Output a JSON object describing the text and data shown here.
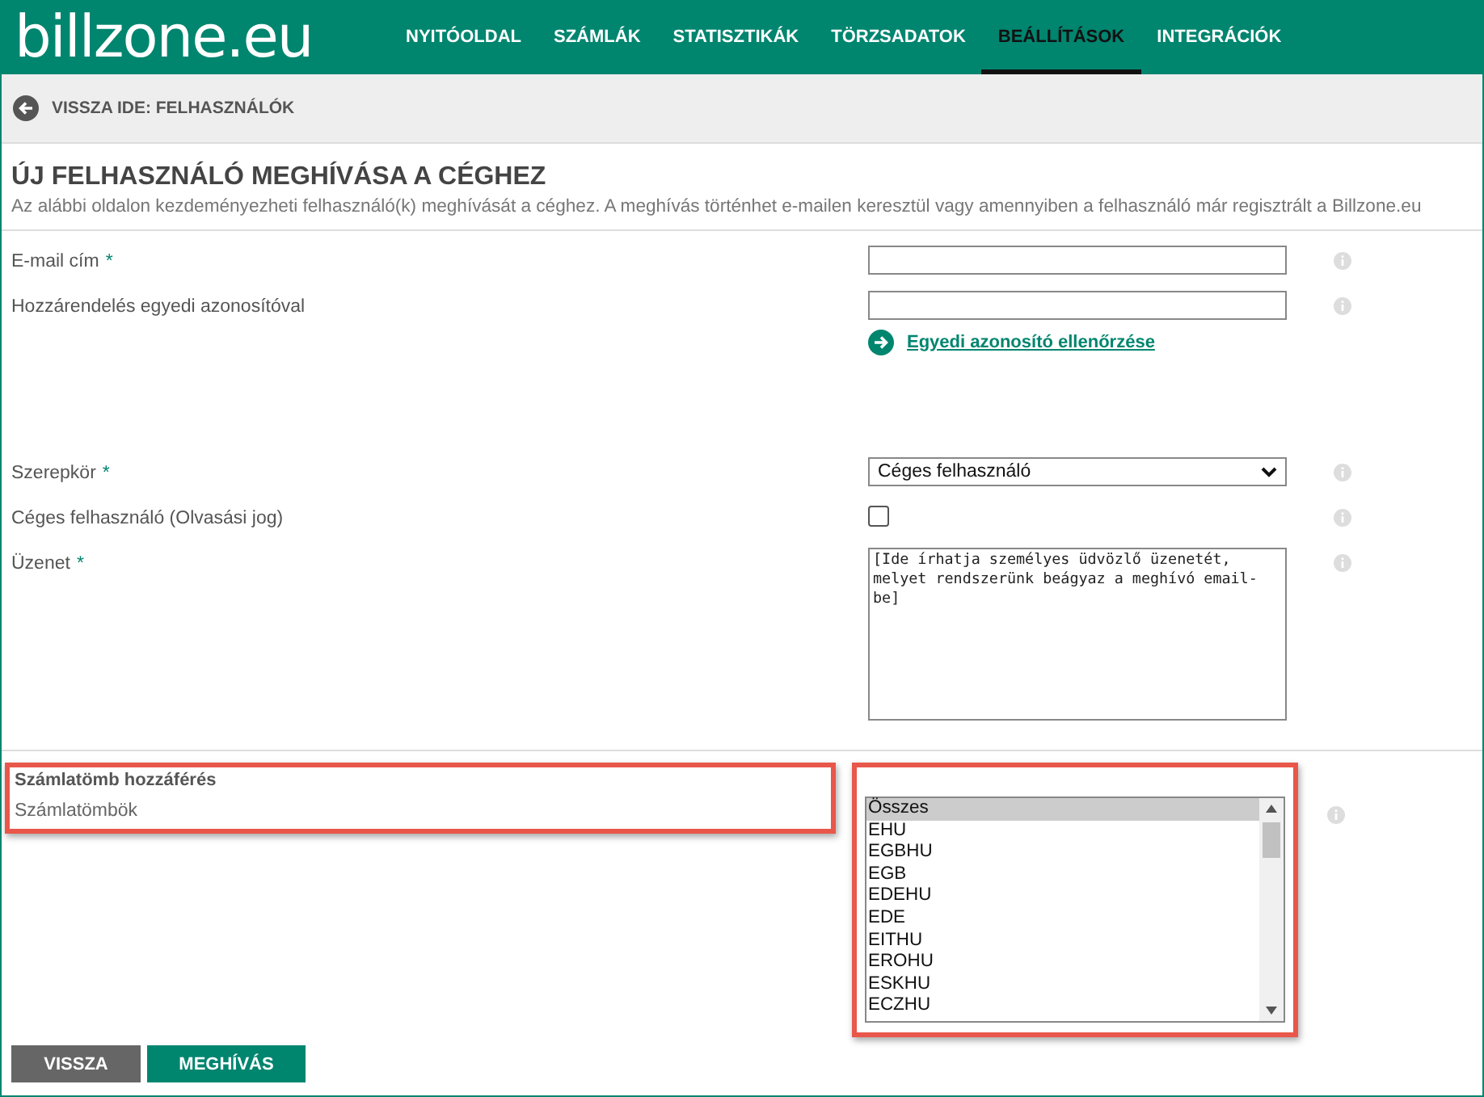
{
  "logo": "billzone.eu",
  "nav": [
    {
      "label": "NYITÓOLDAL",
      "selected": false
    },
    {
      "label": "SZÁMLÁK",
      "selected": false
    },
    {
      "label": "STATISZTIKÁK",
      "selected": false
    },
    {
      "label": "TÖRZSADATOK",
      "selected": false
    },
    {
      "label": "BEÁLLÍTÁSOK",
      "selected": true
    },
    {
      "label": "INTEGRÁCIÓK",
      "selected": false
    }
  ],
  "back_link": "VISSZA IDE: FELHASZNÁLÓK",
  "title": "ÚJ FELHASZNÁLÓ MEGHÍVÁSA A CÉGHEZ",
  "description": "Az alábbi oldalon kezdeményezheti felhasználó(k) meghívását a céghez. A meghívás történhet e-mailen keresztül vagy amennyiben a felhasználó már regisztrált a Billzone.eu",
  "fields": [
    {
      "kind": "text",
      "label": "E-mail cím",
      "required_mark": "*"
    },
    {
      "kind": "text",
      "label": "Hozzárendelés egyedi azonosítóval",
      "link": "Egyedi azonosító ellenőrzése"
    },
    {
      "kind": "select",
      "label": "Szerepkör",
      "required_mark": "*",
      "value": "Céges felhasználó"
    },
    {
      "kind": "checkbox",
      "label": "Céges felhasználó (Olvasási jog)",
      "checked": false
    },
    {
      "kind": "textarea",
      "label": "Üzenet",
      "required_mark": "*",
      "value": "[Ide írhatja személyes üdvözlő üzenetét, melyet rendszerünk beágyaz a meghívó email-be]"
    }
  ],
  "section": {
    "heading": "Számlatömb hozzáférés",
    "label": "Számlatömbök",
    "options": [
      {
        "label": "Összes",
        "selected": true
      },
      {
        "label": "EHU",
        "selected": false
      },
      {
        "label": "EGBHU",
        "selected": false
      },
      {
        "label": "EGB",
        "selected": false
      },
      {
        "label": "EDEHU",
        "selected": false
      },
      {
        "label": "EDE",
        "selected": false
      },
      {
        "label": "EITHU",
        "selected": false
      },
      {
        "label": "EROHU",
        "selected": false
      },
      {
        "label": "ESKHU",
        "selected": false
      },
      {
        "label": "ECZHU",
        "selected": false
      }
    ]
  },
  "buttons": [
    {
      "label": "VISSZA",
      "kind": "secondary"
    },
    {
      "label": "MEGHÍVÁS",
      "kind": "primary"
    }
  ]
}
